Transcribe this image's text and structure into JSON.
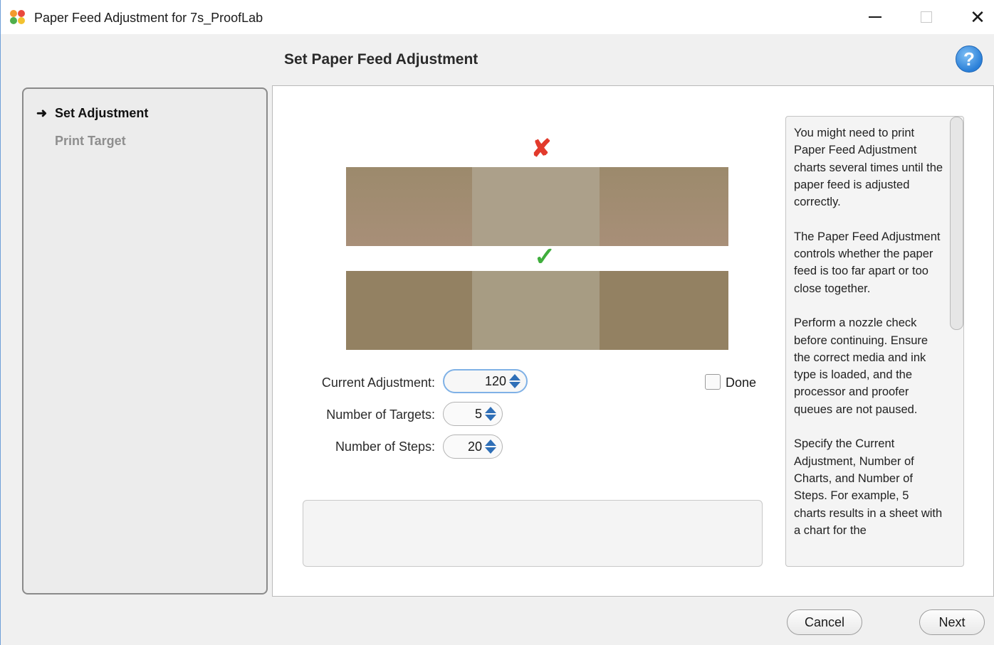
{
  "window": {
    "title": "Paper Feed Adjustment for 7s_ProofLab",
    "minimize_icon": "minimize-icon",
    "maximize_icon": "maximize-icon",
    "close_glyph": "✕"
  },
  "header": {
    "title": "Set Paper Feed Adjustment",
    "help_glyph": "?"
  },
  "sidebar": {
    "arrow_glyph": "➜",
    "steps": [
      {
        "label": "Set Adjustment",
        "active": true
      },
      {
        "label": "Print Target",
        "active": false
      }
    ]
  },
  "preview": {
    "bad_mark": "✘",
    "good_mark": "✓",
    "colors": {
      "bad": "#e23a2c",
      "good": "#3fae3c"
    }
  },
  "form": {
    "current_adjustment": {
      "label": "Current Adjustment:",
      "value": "120"
    },
    "number_of_targets": {
      "label": "Number of Targets:",
      "value": "5"
    },
    "number_of_steps": {
      "label": "Number of Steps:",
      "value": "20"
    },
    "done": {
      "label": "Done",
      "checked": false
    }
  },
  "help_panel": {
    "paragraphs": [
      "You might need to print Paper Feed Adjustment charts several times until the paper feed is adjusted correctly.",
      "The Paper Feed Adjustment controls whether the paper feed is too far apart or too close together.",
      "Perform a nozzle check before continuing. Ensure the correct media and ink type is loaded, and the processor and proofer queues are not paused.",
      "Specify the Current Adjustment, Number of Charts, and Number of Steps. For example, 5 charts results in a sheet with a chart for the"
    ]
  },
  "footer": {
    "cancel_label": "Cancel",
    "next_label": "Next"
  }
}
